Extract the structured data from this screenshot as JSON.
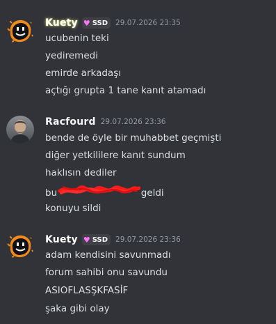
{
  "messages": [
    {
      "author": "Kuety",
      "tag": "SSD",
      "timestamp": "29.07.2026 23:35",
      "lines": [
        "ucubenin teki",
        "yediremedi",
        "emirde arkadaşı",
        "açtığı grupta 1 tane kanıt atamadı"
      ]
    },
    {
      "author": "Racfourd",
      "timestamp": "29.07.2026 23:36",
      "lines": [
        "bende de öyle bir muhabbet geçmişti",
        "diğer yetkililere kanıt sundum",
        "haklısın dediler"
      ],
      "redacted_line": {
        "prefix": "bu",
        "suffix": "geldi"
      },
      "last_line": "konuyu sildi"
    },
    {
      "author": "Kuety",
      "tag": "SSD",
      "timestamp": "29.07.2026 23:36",
      "lines": [
        "adam kendisini savunmadı",
        "forum sahibi onu savundu",
        "ASIOFLASŞKFASİF",
        "şaka gibi olay"
      ]
    }
  ],
  "colors": {
    "background": "#313338",
    "text": "#dbdee1",
    "muted": "#949ba4",
    "tag_heart": "#ff73fa",
    "redaction": "#ff1a1a"
  },
  "icons": {
    "kuety_avatar": "smiley-face-avatar",
    "tag_icon": "heart-icon",
    "racfourd_avatar": "person-photo-avatar"
  }
}
